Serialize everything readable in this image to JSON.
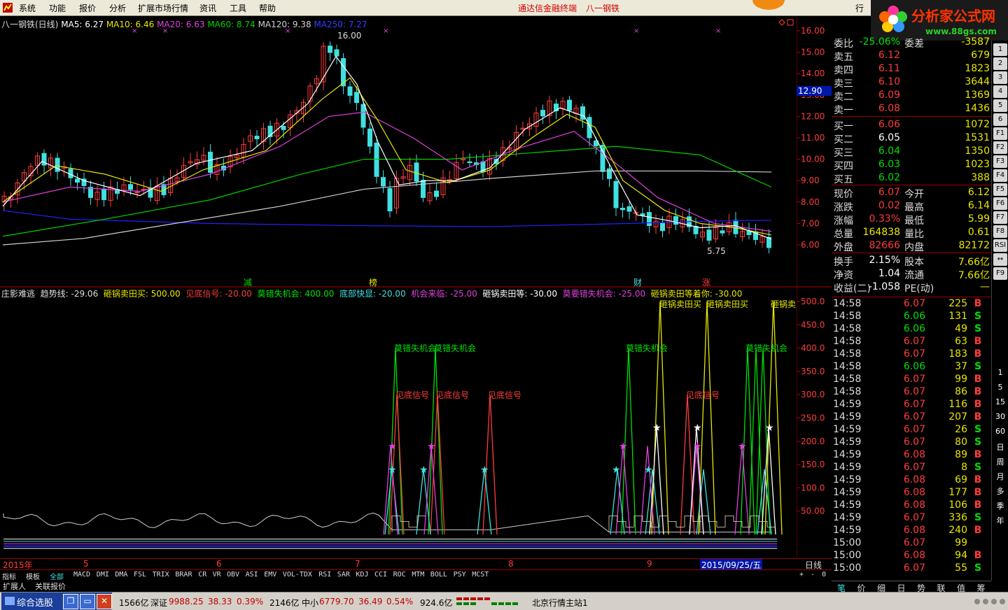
{
  "menu": {
    "items": [
      "系统",
      "功能",
      "报价",
      "分析",
      "扩展市场行情",
      "资讯",
      "工具",
      "帮助"
    ],
    "center_title": "通达信金融终端",
    "stock_title": "八一钢铁",
    "right_label": "行"
  },
  "brand": {
    "name": "分析家公式网",
    "url": "www.88gs.com"
  },
  "price_chart": {
    "header": {
      "name": "八一钢铁(日线)",
      "ma5": "MA5: 6.27",
      "ma10": "MA10: 6.46",
      "ma20": "MA20: 6.63",
      "ma60": "MA60: 8.74",
      "ma120": "MA120: 9.38",
      "ma250": "MA250: 7.27"
    },
    "high_label": "16.00",
    "low_label": "5.75",
    "markers": [
      "减",
      "榜",
      "财",
      "涨"
    ],
    "y_ticks": [
      "16.00",
      "15.00",
      "14.00",
      "13.00",
      "12.00",
      "11.00",
      "10.00",
      "9.00",
      "8.00",
      "7.00",
      "6.00"
    ],
    "cursor_price": "12.90",
    "colors": {
      "up": "#ff3c3c",
      "down": "#40e0e0",
      "ma5": "#ffffff",
      "ma10": "#e8e800",
      "ma20": "#e040e0",
      "ma60": "#00d000",
      "ma120": "#d0d0d0",
      "ma250": "#2020ff"
    }
  },
  "indicator": {
    "header": {
      "name": "庄影难逃",
      "trend": "趋势线: -29.06",
      "s1": "砸锅卖田买: 500.00",
      "s2": "见底信号: -20.00",
      "s3": "莫错失机会: 400.00",
      "s4": "底部快显: -20.00",
      "s5": "机会来临: -25.00",
      "s6": "砸锅卖田等: -30.00",
      "s7": "莫要错失机会: -25.00",
      "s8": "砸锅卖田等着你: -30.00"
    },
    "y_ticks": [
      "500.0",
      "450.0",
      "400.0",
      "350.0",
      "300.0",
      "250.0",
      "200.0",
      "150.0",
      "100.0",
      "50.00"
    ],
    "labels": {
      "miss1": "莫错失机会",
      "miss2": "莫错失机会",
      "miss3": "莫错失机会",
      "miss4": "莫错失机会",
      "bottom1": "见底信号",
      "bottom2": "见底信号",
      "bottom3": "见底信号",
      "bottom4": "见底信号",
      "buy1": "砸锅卖田买",
      "buy2": "砸锅卖田买",
      "buy3": "砸锅卖"
    }
  },
  "date_axis": {
    "labels": [
      "2015年",
      "5",
      "6",
      "7",
      "8",
      "9"
    ],
    "cursor_date": "2015/09/25/五",
    "period": "日线"
  },
  "indicator_tabs": [
    "指标",
    "模板",
    "全部",
    "MACD",
    "DMI",
    "DMA",
    "FSL",
    "TRIX",
    "BRAR",
    "CR",
    "VR",
    "OBV",
    "ASI",
    "EMV",
    "VOL-TDX",
    "RSI",
    "SAR",
    "KDJ",
    "CCI",
    "ROC",
    "MTM",
    "BOLL",
    "PSY",
    "MCST"
  ],
  "zoom_controls": [
    "+",
    "-",
    "0"
  ],
  "bottom_tabs": [
    "扩展人",
    "关联报价"
  ],
  "quote": {
    "weibi": {
      "label": "委比",
      "val": "-25.06%",
      "label2": "委差",
      "val2": "-3587"
    },
    "sell": [
      {
        "label": "卖五",
        "price": "6.12",
        "vol": "679"
      },
      {
        "label": "卖四",
        "price": "6.11",
        "vol": "1823"
      },
      {
        "label": "卖三",
        "price": "6.10",
        "vol": "3644"
      },
      {
        "label": "卖二",
        "price": "6.09",
        "vol": "1369"
      },
      {
        "label": "卖一",
        "price": "6.08",
        "vol": "1436"
      }
    ],
    "buy": [
      {
        "label": "买一",
        "price": "6.06",
        "vol": "1072"
      },
      {
        "label": "买二",
        "price": "6.05",
        "vol": "1531"
      },
      {
        "label": "买三",
        "price": "6.04",
        "vol": "1350"
      },
      {
        "label": "买四",
        "price": "6.03",
        "vol": "1023"
      },
      {
        "label": "买五",
        "price": "6.02",
        "vol": "388"
      }
    ],
    "stats": [
      {
        "l1": "现价",
        "v1": "6.07",
        "l2": "今开",
        "v2": "6.12"
      },
      {
        "l1": "涨跌",
        "v1": "0.02",
        "l2": "最高",
        "v2": "6.14"
      },
      {
        "l1": "涨幅",
        "v1": "0.33%",
        "l2": "最低",
        "v2": "5.99"
      },
      {
        "l1": "总量",
        "v1": "164838",
        "l2": "量比",
        "v2": "0.61"
      },
      {
        "l1": "外盘",
        "v1": "82666",
        "l2": "内盘",
        "v2": "82172"
      }
    ],
    "stats2": [
      {
        "l1": "换手",
        "v1": "2.15%",
        "l2": "股本",
        "v2": "7.66亿"
      },
      {
        "l1": "净资",
        "v1": "1.04",
        "l2": "流通",
        "v2": "7.66亿"
      },
      {
        "l1": "收益(二)",
        "v1": "-1.058",
        "l2": "PE(动)",
        "v2": "—"
      }
    ]
  },
  "ticks": [
    {
      "t": "14:58",
      "p": "6.07",
      "v": "225",
      "d": "B"
    },
    {
      "t": "14:58",
      "p": "6.06",
      "v": "131",
      "d": "S"
    },
    {
      "t": "14:58",
      "p": "6.06",
      "v": "49",
      "d": "S"
    },
    {
      "t": "14:58",
      "p": "6.07",
      "v": "63",
      "d": "B"
    },
    {
      "t": "14:58",
      "p": "6.07",
      "v": "183",
      "d": "B"
    },
    {
      "t": "14:58",
      "p": "6.06",
      "v": "37",
      "d": "S"
    },
    {
      "t": "14:58",
      "p": "6.07",
      "v": "99",
      "d": "B"
    },
    {
      "t": "14:58",
      "p": "6.07",
      "v": "86",
      "d": "B"
    },
    {
      "t": "14:59",
      "p": "6.07",
      "v": "116",
      "d": "B"
    },
    {
      "t": "14:59",
      "p": "6.07",
      "v": "207",
      "d": "B"
    },
    {
      "t": "14:59",
      "p": "6.07",
      "v": "26",
      "d": "S"
    },
    {
      "t": "14:59",
      "p": "6.07",
      "v": "80",
      "d": "S"
    },
    {
      "t": "14:59",
      "p": "6.08",
      "v": "89",
      "d": "B"
    },
    {
      "t": "14:59",
      "p": "6.07",
      "v": "8",
      "d": "S"
    },
    {
      "t": "14:59",
      "p": "6.08",
      "v": "69",
      "d": "B"
    },
    {
      "t": "14:59",
      "p": "6.08",
      "v": "177",
      "d": "B"
    },
    {
      "t": "14:59",
      "p": "6.08",
      "v": "106",
      "d": "B"
    },
    {
      "t": "14:59",
      "p": "6.07",
      "v": "336",
      "d": "S"
    },
    {
      "t": "14:59",
      "p": "6.08",
      "v": "240",
      "d": "B"
    },
    {
      "t": "15:00",
      "p": "6.07",
      "v": "99",
      "d": ""
    },
    {
      "t": "15:00",
      "p": "6.08",
      "v": "94",
      "d": "B"
    },
    {
      "t": "15:00",
      "p": "6.07",
      "v": "55",
      "d": "S"
    }
  ],
  "sidebar": {
    "buttons": [
      "1",
      "2",
      "3",
      "4",
      "5",
      "6",
      "F1",
      "F2",
      "F3",
      "F4",
      "F5",
      "F6",
      "F7",
      "F8",
      "RSI",
      "↔",
      "F9"
    ],
    "periods": [
      "1",
      "5",
      "15",
      "30",
      "60",
      "日",
      "周",
      "月",
      "多",
      "季",
      "年"
    ]
  },
  "right_tabs": [
    "笔",
    "价",
    "细",
    "日",
    "势",
    "联",
    "值",
    "筹"
  ],
  "status": {
    "selector": "综合选股",
    "v1": "1566亿",
    "sz_label": "深证",
    "sz_val": "9988.25",
    "sz_chg": "38.33",
    "sz_pct": "0.39%",
    "sz_amt": "2146亿",
    "zx_label": "中小",
    "zx_val": "6779.70",
    "zx_chg": "36.49",
    "zx_pct": "0.54%",
    "zx_amt": "924.6亿",
    "server": "北京行情主站1"
  }
}
